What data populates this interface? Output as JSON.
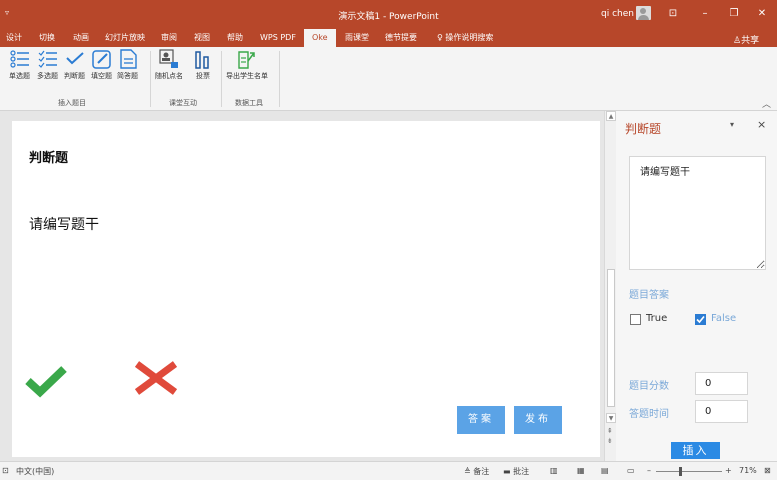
{
  "titlebar": {
    "qat": "▿",
    "title": "演示文稿1  -  PowerPoint",
    "user": "qi chen",
    "controls": [
      "⊡",
      "–",
      "❐",
      "✕"
    ]
  },
  "tabs": [
    {
      "label": "设计"
    },
    {
      "label": "切换"
    },
    {
      "label": "动画"
    },
    {
      "label": "幻灯片放映"
    },
    {
      "label": "审阅"
    },
    {
      "label": "视图"
    },
    {
      "label": "帮助"
    },
    {
      "label": "WPS PDF"
    },
    {
      "label": "Oke"
    },
    {
      "label": "雨课堂"
    },
    {
      "label": "德节提要"
    },
    {
      "label": "操作说明搜索"
    }
  ],
  "share": "共享",
  "ribbon": {
    "insert_questions": {
      "buttons": [
        "单选题",
        "多选题",
        "判断题",
        "填空题",
        "简答题"
      ],
      "label": "插入题目"
    },
    "classroom": {
      "buttons": [
        "随机点名",
        "投票"
      ],
      "label": "课堂互动"
    },
    "data_tools": {
      "buttons": [
        "导出学生名单"
      ],
      "label": "数据工具"
    }
  },
  "slide": {
    "title": "判断题",
    "question": "请编写题干",
    "answer_button": "答案",
    "publish_button": "发布"
  },
  "pane": {
    "title": "判断题",
    "stem": "请编写题干",
    "answer_label": "题目答案",
    "true_label": "True",
    "false_label": "False",
    "score_label": "题目分数",
    "score_value": "0",
    "time_label": "答题时间",
    "time_value": "0",
    "insert_button": "插入"
  },
  "statusbar": {
    "language": "中文(中国)",
    "notes": "备注",
    "comments": "批注",
    "zoom": "71%"
  },
  "colors": {
    "accent": "#b7472a",
    "slide_button": "#5ba3e6",
    "pane_label": "#7aa8d8",
    "insert_button": "#2b8ae4",
    "check_green": "#3aa84a",
    "cross_red": "#e04a3b"
  }
}
